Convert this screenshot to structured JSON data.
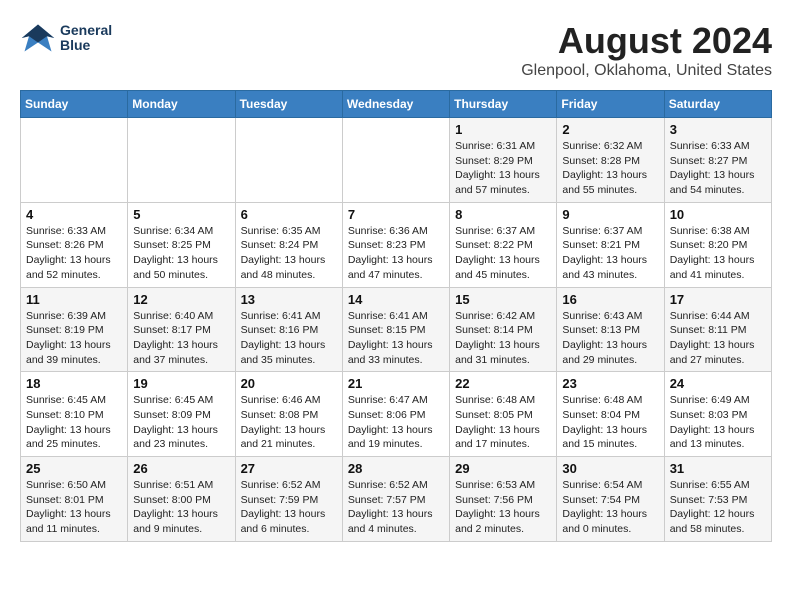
{
  "header": {
    "logo_line1": "General",
    "logo_line2": "Blue",
    "title": "August 2024",
    "subtitle": "Glenpool, Oklahoma, United States"
  },
  "weekdays": [
    "Sunday",
    "Monday",
    "Tuesday",
    "Wednesday",
    "Thursday",
    "Friday",
    "Saturday"
  ],
  "weeks": [
    [
      {
        "day": "",
        "info": ""
      },
      {
        "day": "",
        "info": ""
      },
      {
        "day": "",
        "info": ""
      },
      {
        "day": "",
        "info": ""
      },
      {
        "day": "1",
        "info": "Sunrise: 6:31 AM\nSunset: 8:29 PM\nDaylight: 13 hours\nand 57 minutes."
      },
      {
        "day": "2",
        "info": "Sunrise: 6:32 AM\nSunset: 8:28 PM\nDaylight: 13 hours\nand 55 minutes."
      },
      {
        "day": "3",
        "info": "Sunrise: 6:33 AM\nSunset: 8:27 PM\nDaylight: 13 hours\nand 54 minutes."
      }
    ],
    [
      {
        "day": "4",
        "info": "Sunrise: 6:33 AM\nSunset: 8:26 PM\nDaylight: 13 hours\nand 52 minutes."
      },
      {
        "day": "5",
        "info": "Sunrise: 6:34 AM\nSunset: 8:25 PM\nDaylight: 13 hours\nand 50 minutes."
      },
      {
        "day": "6",
        "info": "Sunrise: 6:35 AM\nSunset: 8:24 PM\nDaylight: 13 hours\nand 48 minutes."
      },
      {
        "day": "7",
        "info": "Sunrise: 6:36 AM\nSunset: 8:23 PM\nDaylight: 13 hours\nand 47 minutes."
      },
      {
        "day": "8",
        "info": "Sunrise: 6:37 AM\nSunset: 8:22 PM\nDaylight: 13 hours\nand 45 minutes."
      },
      {
        "day": "9",
        "info": "Sunrise: 6:37 AM\nSunset: 8:21 PM\nDaylight: 13 hours\nand 43 minutes."
      },
      {
        "day": "10",
        "info": "Sunrise: 6:38 AM\nSunset: 8:20 PM\nDaylight: 13 hours\nand 41 minutes."
      }
    ],
    [
      {
        "day": "11",
        "info": "Sunrise: 6:39 AM\nSunset: 8:19 PM\nDaylight: 13 hours\nand 39 minutes."
      },
      {
        "day": "12",
        "info": "Sunrise: 6:40 AM\nSunset: 8:17 PM\nDaylight: 13 hours\nand 37 minutes."
      },
      {
        "day": "13",
        "info": "Sunrise: 6:41 AM\nSunset: 8:16 PM\nDaylight: 13 hours\nand 35 minutes."
      },
      {
        "day": "14",
        "info": "Sunrise: 6:41 AM\nSunset: 8:15 PM\nDaylight: 13 hours\nand 33 minutes."
      },
      {
        "day": "15",
        "info": "Sunrise: 6:42 AM\nSunset: 8:14 PM\nDaylight: 13 hours\nand 31 minutes."
      },
      {
        "day": "16",
        "info": "Sunrise: 6:43 AM\nSunset: 8:13 PM\nDaylight: 13 hours\nand 29 minutes."
      },
      {
        "day": "17",
        "info": "Sunrise: 6:44 AM\nSunset: 8:11 PM\nDaylight: 13 hours\nand 27 minutes."
      }
    ],
    [
      {
        "day": "18",
        "info": "Sunrise: 6:45 AM\nSunset: 8:10 PM\nDaylight: 13 hours\nand 25 minutes."
      },
      {
        "day": "19",
        "info": "Sunrise: 6:45 AM\nSunset: 8:09 PM\nDaylight: 13 hours\nand 23 minutes."
      },
      {
        "day": "20",
        "info": "Sunrise: 6:46 AM\nSunset: 8:08 PM\nDaylight: 13 hours\nand 21 minutes."
      },
      {
        "day": "21",
        "info": "Sunrise: 6:47 AM\nSunset: 8:06 PM\nDaylight: 13 hours\nand 19 minutes."
      },
      {
        "day": "22",
        "info": "Sunrise: 6:48 AM\nSunset: 8:05 PM\nDaylight: 13 hours\nand 17 minutes."
      },
      {
        "day": "23",
        "info": "Sunrise: 6:48 AM\nSunset: 8:04 PM\nDaylight: 13 hours\nand 15 minutes."
      },
      {
        "day": "24",
        "info": "Sunrise: 6:49 AM\nSunset: 8:03 PM\nDaylight: 13 hours\nand 13 minutes."
      }
    ],
    [
      {
        "day": "25",
        "info": "Sunrise: 6:50 AM\nSunset: 8:01 PM\nDaylight: 13 hours\nand 11 minutes."
      },
      {
        "day": "26",
        "info": "Sunrise: 6:51 AM\nSunset: 8:00 PM\nDaylight: 13 hours\nand 9 minutes."
      },
      {
        "day": "27",
        "info": "Sunrise: 6:52 AM\nSunset: 7:59 PM\nDaylight: 13 hours\nand 6 minutes."
      },
      {
        "day": "28",
        "info": "Sunrise: 6:52 AM\nSunset: 7:57 PM\nDaylight: 13 hours\nand 4 minutes."
      },
      {
        "day": "29",
        "info": "Sunrise: 6:53 AM\nSunset: 7:56 PM\nDaylight: 13 hours\nand 2 minutes."
      },
      {
        "day": "30",
        "info": "Sunrise: 6:54 AM\nSunset: 7:54 PM\nDaylight: 13 hours\nand 0 minutes."
      },
      {
        "day": "31",
        "info": "Sunrise: 6:55 AM\nSunset: 7:53 PM\nDaylight: 12 hours\nand 58 minutes."
      }
    ]
  ]
}
